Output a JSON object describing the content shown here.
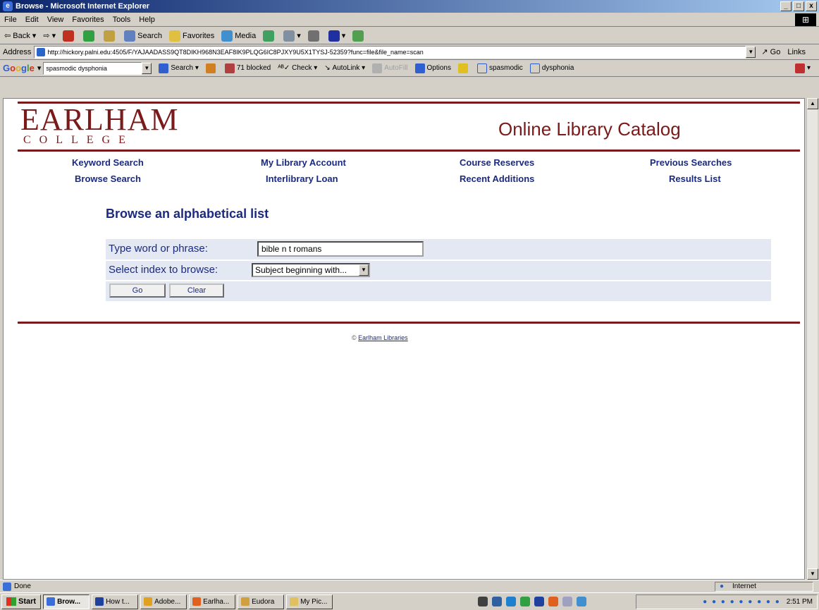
{
  "window": {
    "title": "Browse - Microsoft Internet Explorer",
    "btn_min": "_",
    "btn_max": "□",
    "btn_close": "x"
  },
  "menu": {
    "items": [
      "File",
      "Edit",
      "View",
      "Favorites",
      "Tools",
      "Help"
    ]
  },
  "toolbar": {
    "back": "Back",
    "search": "Search",
    "favorites": "Favorites",
    "media": "Media"
  },
  "address": {
    "label": "Address",
    "url": "http://hickory.palni.edu:4505/F/YAJAADASS9QT8DIKH968N3EAF8IK9PLQG6IC8PJXY9U5X1TYSJ-52359?func=file&file_name=scan",
    "go": "Go",
    "links": "Links"
  },
  "google": {
    "logo": "Google",
    "query": "spasmodic dysphonia",
    "search": "Search",
    "blocked": "71 blocked",
    "check": "Check",
    "autolink": "AutoLink",
    "autofill": "AutoFill",
    "options": "Options",
    "word1": "spasmodic",
    "word2": "dysphonia"
  },
  "page": {
    "logo_main": "EARLHAM",
    "logo_sub": "COLLEGE",
    "catalog_title": "Online Library Catalog",
    "nav": {
      "keyword_search": "Keyword Search",
      "my_library_account": "My Library Account",
      "course_reserves": "Course Reserves",
      "previous_searches": "Previous Searches",
      "browse_search": "Browse Search",
      "interlibrary_loan": "Interlibrary Loan",
      "recent_additions": "Recent Additions",
      "results_list": "Results List"
    },
    "heading": "Browse an alphabetical list",
    "form": {
      "word_label": "Type word or phrase:",
      "word_value": "bible n t romans",
      "index_label": "Select index to browse:",
      "index_value": "Subject beginning with...",
      "go": "Go",
      "clear": "Clear"
    },
    "footer": {
      "copyright": "©",
      "link": "Earlham Libraries"
    }
  },
  "status": {
    "text": "Done",
    "zone": "Internet"
  },
  "taskbar": {
    "start": "Start",
    "tasks": [
      "Brow...",
      "How t...",
      "Adobe...",
      "Earlha...",
      "Eudora",
      "My Pic..."
    ],
    "clock": "2:51 PM"
  },
  "colors": {
    "brand": "#7a1a1a",
    "link": "#1a2a80",
    "panel": "#e4e8f2"
  }
}
